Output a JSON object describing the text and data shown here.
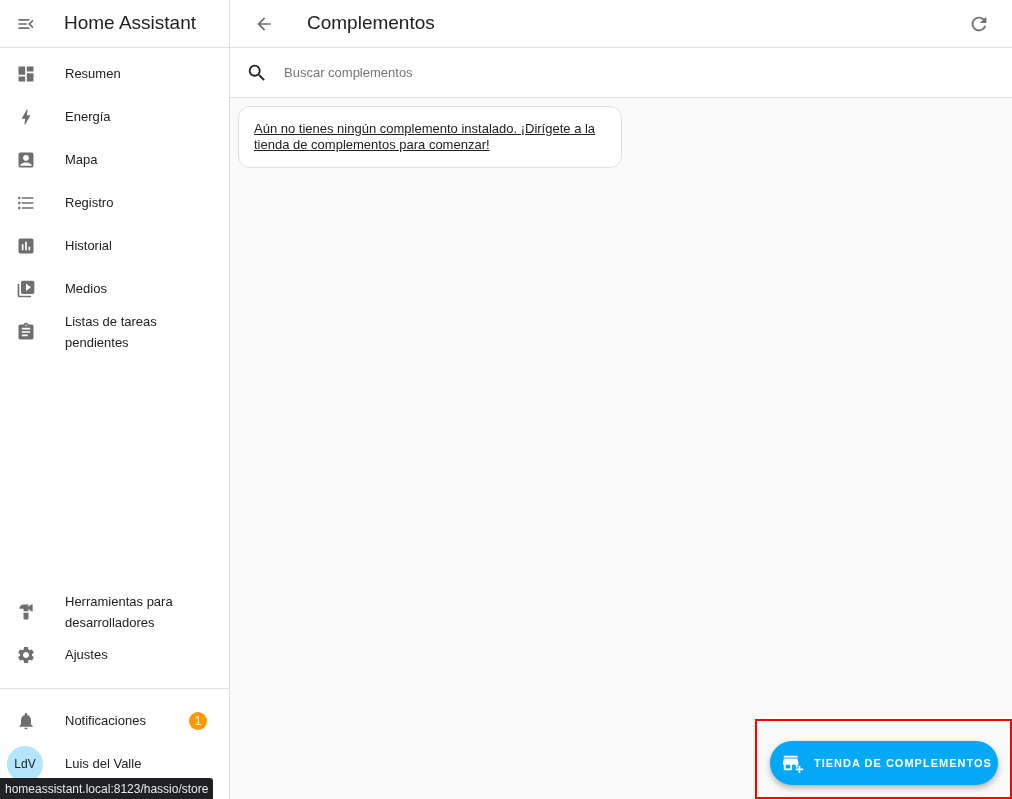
{
  "sidebar": {
    "title": "Home Assistant",
    "items": [
      {
        "label": "Resumen"
      },
      {
        "label": "Energía"
      },
      {
        "label": "Mapa"
      },
      {
        "label": "Registro"
      },
      {
        "label": "Historial"
      },
      {
        "label": "Medios"
      },
      {
        "label": "Listas de tareas pendientes"
      }
    ],
    "bottom_items": [
      {
        "label": "Herramientas para desarrolladores"
      },
      {
        "label": "Ajustes"
      }
    ],
    "notifications": {
      "label": "Notificaciones",
      "badge": "1"
    },
    "user": {
      "initials": "LdV",
      "name": "Luis del Valle"
    }
  },
  "header": {
    "title": "Complementos"
  },
  "search": {
    "placeholder": "Buscar complementos"
  },
  "empty_message": "Aún no tienes ningún complemento instalado. ¡Dirígete a la tienda de complementos para comenzar!",
  "fab": {
    "label": "TIENDA DE COMPLEMENTOS"
  },
  "status_url": "homeassistant.local:8123/hassio/store"
}
